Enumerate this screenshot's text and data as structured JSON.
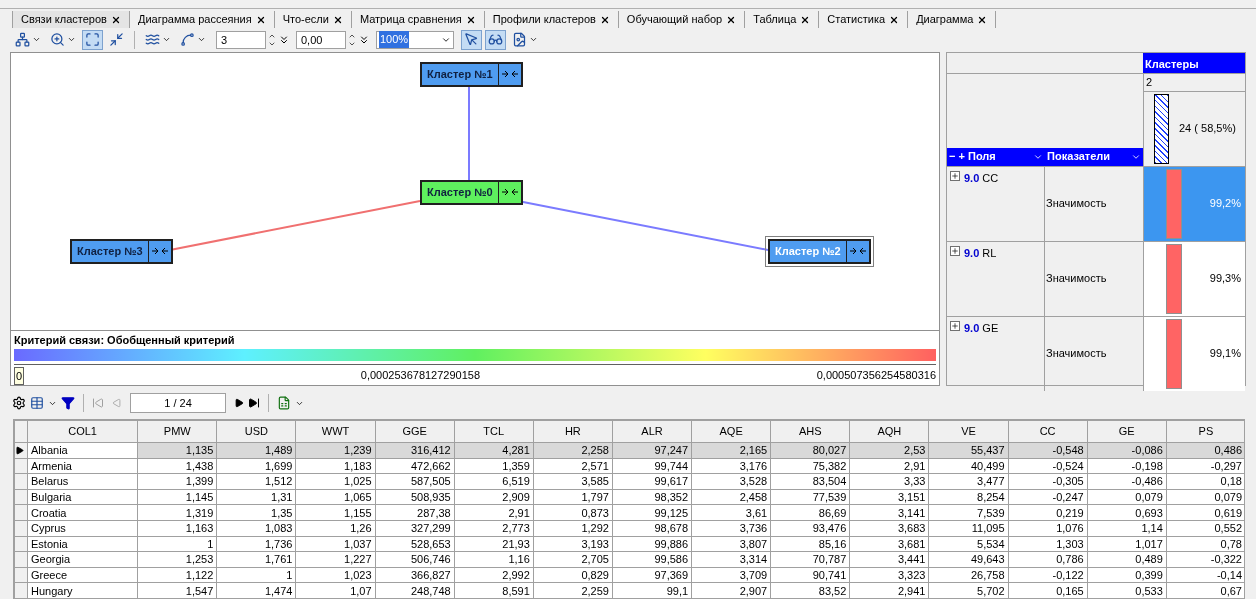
{
  "tabs": [
    {
      "label": "Связи кластеров",
      "selected": true
    },
    {
      "label": "Диаграмма рассеяния",
      "selected": false
    },
    {
      "label": "Что-если",
      "selected": false
    },
    {
      "label": "Матрица сравнения",
      "selected": false
    },
    {
      "label": "Профили кластеров",
      "selected": false
    },
    {
      "label": "Обучающий набор",
      "selected": false
    },
    {
      "label": "Таблица",
      "selected": false
    },
    {
      "label": "Статистика",
      "selected": false
    },
    {
      "label": "Диаграмма",
      "selected": false
    }
  ],
  "toolbar": {
    "buttons": [
      {
        "pressed": false
      },
      {
        "pressed": false
      },
      {
        "pressed": true
      },
      {
        "pressed": false
      },
      {
        "pressed": false
      },
      {
        "pressed": false
      },
      {
        "pressed": true
      },
      {
        "pressed": true
      },
      {
        "pressed": false
      }
    ],
    "spin_values": [
      "3",
      "0,00"
    ],
    "zoom": "100%"
  },
  "diagram": {
    "nodes": [
      {
        "label": "Кластер №1",
        "color": "#4f9cf0",
        "selected": false
      },
      {
        "label": "Кластер №0",
        "color": "#5ef05e",
        "selected": false
      },
      {
        "label": "Кластер №3",
        "color": "#4f9cf0",
        "selected": false
      },
      {
        "label": "Кластер №2",
        "color": "#4f9cf0",
        "selected": true
      }
    ],
    "edges": [
      {
        "color": "#7b7bff"
      },
      {
        "color": "#f07070"
      },
      {
        "color": "#7b7bff"
      }
    ],
    "legend": {
      "title": "Критерий связи: Обобщенный критерий",
      "ticks": [
        "0",
        "0,000253678127290158",
        "0,000507356254580316"
      ]
    }
  },
  "cube": {
    "header": "Кластеры",
    "cluster": "2",
    "count": "24 ( 58,5%)",
    "expand_controls": "− +",
    "field_header": "Поля",
    "measure_header": "Показатели",
    "rows": [
      {
        "code": "9.0",
        "field": "CC",
        "measure": "Значимость",
        "value": "99,2%",
        "level": 0.992,
        "selected": true
      },
      {
        "code": "9.0",
        "field": "RL",
        "measure": "Значимость",
        "value": "99,3%",
        "level": 0.993,
        "selected": false
      },
      {
        "code": "9.0",
        "field": "GE",
        "measure": "Значимость",
        "value": "99,1%",
        "level": 0.991,
        "selected": false
      }
    ]
  },
  "navigator": {
    "page": "1 / 24"
  },
  "table": {
    "columns": [
      "COL1",
      "PMW",
      "USD",
      "WWT",
      "GGE",
      "TCL",
      "HR",
      "ALR",
      "AQE",
      "AHS",
      "AQH",
      "VE",
      "CC",
      "GE",
      "PS"
    ],
    "rows": [
      {
        "selected": true,
        "cells": [
          "Albania",
          "1,135",
          "1,489",
          "1,239",
          "316,412",
          "4,281",
          "2,258",
          "97,247",
          "2,165",
          "80,027",
          "2,53",
          "55,437",
          "-0,548",
          "-0,086",
          "0,486"
        ]
      },
      {
        "selected": false,
        "cells": [
          "Armenia",
          "1,438",
          "1,699",
          "1,183",
          "472,662",
          "1,359",
          "2,571",
          "99,744",
          "3,176",
          "75,382",
          "2,91",
          "40,499",
          "-0,524",
          "-0,198",
          "-0,297"
        ]
      },
      {
        "selected": false,
        "cells": [
          "Belarus",
          "1,399",
          "1,512",
          "1,025",
          "587,505",
          "6,519",
          "3,585",
          "99,617",
          "3,528",
          "83,504",
          "3,33",
          "3,477",
          "-0,305",
          "-0,486",
          "0,18"
        ]
      },
      {
        "selected": false,
        "cells": [
          "Bulgaria",
          "1,145",
          "1,31",
          "1,065",
          "508,935",
          "2,909",
          "1,797",
          "98,352",
          "2,458",
          "77,539",
          "3,151",
          "8,254",
          "-0,247",
          "0,079",
          "0,079"
        ]
      },
      {
        "selected": false,
        "cells": [
          "Croatia",
          "1,319",
          "1,35",
          "1,155",
          "287,38",
          "2,91",
          "0,873",
          "99,125",
          "3,61",
          "86,69",
          "3,141",
          "7,539",
          "0,219",
          "0,693",
          "0,619"
        ]
      },
      {
        "selected": false,
        "cells": [
          "Cyprus",
          "1,163",
          "1,083",
          "1,26",
          "327,299",
          "2,773",
          "1,292",
          "98,678",
          "3,736",
          "93,476",
          "3,683",
          "11,095",
          "1,076",
          "1,14",
          "0,552"
        ]
      },
      {
        "selected": false,
        "cells": [
          "Estonia",
          "1",
          "1,736",
          "1,037",
          "528,653",
          "21,93",
          "3,193",
          "99,886",
          "3,807",
          "85,16",
          "3,681",
          "5,534",
          "1,303",
          "1,017",
          "0,78"
        ]
      },
      {
        "selected": false,
        "cells": [
          "Georgia",
          "1,253",
          "1,761",
          "1,227",
          "506,746",
          "1,16",
          "2,705",
          "99,586",
          "3,314",
          "70,787",
          "3,441",
          "49,643",
          "0,786",
          "0,489",
          "-0,322"
        ]
      },
      {
        "selected": false,
        "cells": [
          "Greece",
          "1,122",
          "1",
          "1,023",
          "366,827",
          "2,992",
          "0,829",
          "97,369",
          "3,709",
          "90,741",
          "3,323",
          "26,758",
          "-0,122",
          "0,399",
          "-0,14"
        ]
      },
      {
        "selected": false,
        "cells": [
          "Hungary",
          "1,547",
          "1,474",
          "1,07",
          "248,748",
          "8,591",
          "2,259",
          "99,1",
          "2,907",
          "83,52",
          "2,941",
          "5,702",
          "0,165",
          "0,533",
          "0,67"
        ]
      }
    ]
  }
}
